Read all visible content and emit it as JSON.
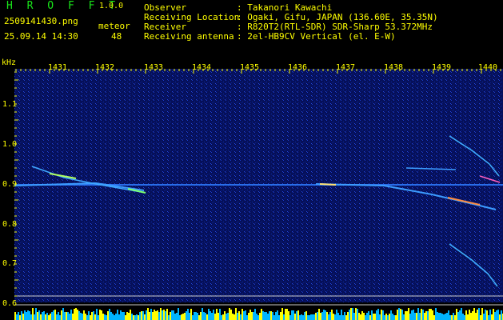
{
  "header": {
    "app_title": "H R O F F T",
    "version": "1.0.0",
    "filename": "2509141430.png",
    "timestamp": "25.09.14 14:30",
    "meteor_label": "meteor",
    "meteor_count": "48"
  },
  "info": [
    {
      "key": "Observer",
      "value": ": Takanori Kawachi"
    },
    {
      "key": "Receiving Location",
      "value": ": Ogaki, Gifu, JAPAN (136.60E, 35.35N)"
    },
    {
      "key": "Receiver",
      "value": ": R820T2(RTL-SDR) SDR-Sharp 53.372MHz"
    },
    {
      "key": "Receiving antenna",
      "value": ": 2el-HB9CV Vertical (el. E-W)"
    }
  ],
  "axis": {
    "y_unit": "kHz",
    "x_ticks": [
      "1431",
      "1432",
      "1433",
      "1434",
      "1435",
      "1436",
      "1437",
      "1438",
      "1439",
      "1440"
    ],
    "y_ticks": [
      "1.1",
      "1.0",
      "0.9",
      "0.8",
      "0.7",
      "0.6"
    ]
  },
  "colors": {
    "background": "#000000",
    "spectrum_bg": "#06105a",
    "text": "#ffff00",
    "title": "#19e61a",
    "trace": "#3c9cff",
    "echo_hot": "#ff8c40",
    "level_bars": "#00b4ff",
    "level_peaks": "#ffff00"
  }
}
